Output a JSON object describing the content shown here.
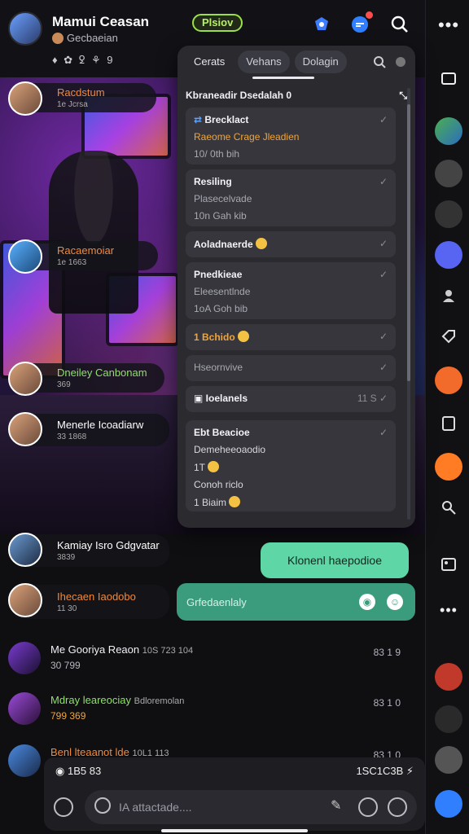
{
  "header": {
    "name": "Mamui Ceasan",
    "sub": "Gecbaeian",
    "status_icons": "♦ ✿  ꝿ ⚘ 9",
    "badge": "Plsiov"
  },
  "panel": {
    "tabs": [
      "Cerats",
      "Vehans",
      "Dolagin"
    ],
    "heading": "Kbraneadir Dsedalah",
    "heading_num": "0",
    "cards": [
      {
        "title": "Brecklact",
        "line2": "Raeome Crage Jleadien",
        "line3": "10/ 0th bih"
      },
      {
        "title": "Resiling",
        "line2": "Plasecelvade",
        "line3": "10n Gah kib"
      },
      {
        "title": "Aoladnaerde",
        "emoji": true
      },
      {
        "title": "Pnedkieae",
        "line2": "Eleesentlnde",
        "line3": "1oA Goh bib"
      },
      {
        "title": "1 Bchido",
        "emoji": true
      },
      {
        "title": "Hseornvive"
      },
      {
        "title": "Ioelanels",
        "right": "11 S"
      },
      {
        "title": "Ebt Beacioe",
        "line2": "Demeheeoaodio",
        "line3": "1T",
        "line4": "Conoh riclo",
        "line5": "1 Biaim"
      }
    ]
  },
  "tags": [
    {
      "name": "Racdstum",
      "sub": "1e Jcrsa"
    },
    {
      "name": "Racaemoiar",
      "sub": "1e 1663"
    },
    {
      "name": "Dneiley Canbonam",
      "sub": "369"
    },
    {
      "name": "Menerle Icoadiarw",
      "sub": "33 1868"
    },
    {
      "name": "Kamiay Isro Gdgvatar",
      "sub": "3839"
    },
    {
      "name": "Ihecaen Iaodobo",
      "sub": "11 30"
    }
  ],
  "messages": {
    "outgoing": "Klonenl haepodioe",
    "reply_placeholder": "Grfedaenlaly"
  },
  "chats": [
    {
      "name": "Me Gooriya Reaon",
      "time": "10S 723 104",
      "sub": "30 799",
      "right": "83 1 9"
    },
    {
      "name": "Mdray leareociay",
      "time": "Bdloremolan",
      "sub": "799 369",
      "right": "83 1 0"
    },
    {
      "name": "Benl lteaanot lde",
      "time": "10L1 113",
      "sub": "",
      "right": "83 1 0"
    }
  ],
  "composer": {
    "status_left": "1B5 83",
    "status_right": "1SC1C3B",
    "placeholder": "IA attactade...."
  }
}
